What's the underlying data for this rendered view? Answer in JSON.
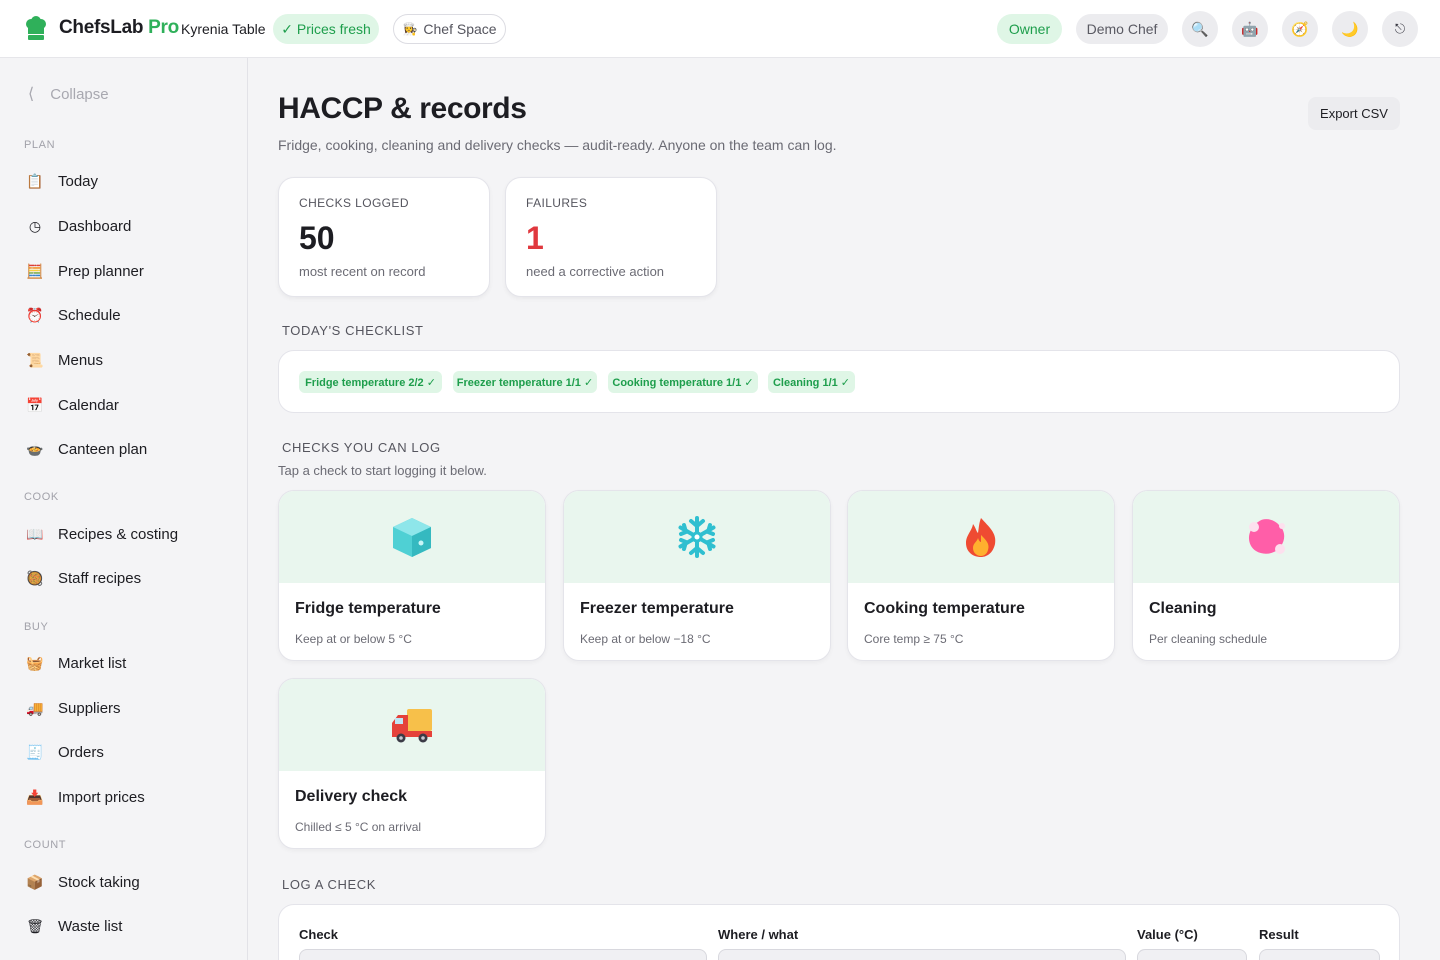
{
  "topbar": {
    "brand": "ChefsLab",
    "brand_pro": "Pro",
    "venue": "Kyrenia Table",
    "prices_fresh": "✓ Prices fresh",
    "chef_space": "Chef Space",
    "role": "Owner",
    "user": "Demo Chef",
    "icons": [
      "search-icon",
      "robot-icon",
      "compass-icon",
      "moon-icon",
      "logout-icon"
    ]
  },
  "sidebar": {
    "collapse": "Collapse",
    "sections": {
      "plan": "PLAN",
      "cook": "COOK",
      "buy": "BUY",
      "count": "COUNT"
    },
    "items": {
      "today": "Today",
      "dashboard": "Dashboard",
      "prep_planner": "Prep planner",
      "schedule": "Schedule",
      "menus": "Menus",
      "calendar": "Calendar",
      "canteen_plan": "Canteen plan",
      "recipes_costing": "Recipes & costing",
      "staff_recipes": "Staff recipes",
      "market_list": "Market list",
      "suppliers": "Suppliers",
      "orders": "Orders",
      "import_prices": "Import prices",
      "stock_taking": "Stock taking",
      "waste_list": "Waste list"
    }
  },
  "main": {
    "title": "HACCP & records",
    "subtitle": "Fridge, cooking, cleaning and delivery checks — audit-ready. Anyone on the team can log.",
    "export": "Export CSV",
    "stats": {
      "logged_label": "CHECKS LOGGED",
      "logged_value": "50",
      "logged_desc": "most recent on record",
      "failures_label": "FAILURES",
      "failures_value": "1",
      "failures_desc": "need a corrective action"
    },
    "checklist_heading": "TODAY'S CHECKLIST",
    "checklist": {
      "fridge": "Fridge temperature 2/2 ✓",
      "freezer": "Freezer temperature 1/1 ✓",
      "cooking": "Cooking temperature 1/1 ✓",
      "cleaning": "Cleaning 1/1 ✓"
    },
    "checks_heading": "CHECKS YOU CAN LOG",
    "checks_note": "Tap a check to start logging it below.",
    "checks": {
      "fridge": {
        "title": "Fridge temperature",
        "desc": "Keep at or below 5 °C",
        "icon": "ice-cube-icon"
      },
      "freezer": {
        "title": "Freezer temperature",
        "desc": "Keep at or below −18 °C",
        "icon": "snowflake-icon"
      },
      "cooking": {
        "title": "Cooking temperature",
        "desc": "Core temp ≥ 75 °C",
        "icon": "fire-icon"
      },
      "cleaning": {
        "title": "Cleaning",
        "desc": "Per cleaning schedule",
        "icon": "sponge-icon"
      },
      "delivery": {
        "title": "Delivery check",
        "desc": "Chilled ≤ 5 °C on arrival",
        "icon": "truck-icon"
      }
    },
    "log_heading": "LOG A CHECK",
    "log": {
      "check": "Check",
      "where": "Where / what",
      "value": "Value (°C)",
      "result": "Result"
    }
  },
  "colors": {
    "accent_green": "#2fb05a",
    "chip_bg": "#dff6e6",
    "failure_red": "#e0383e",
    "card_band": "#e9f6ee"
  }
}
